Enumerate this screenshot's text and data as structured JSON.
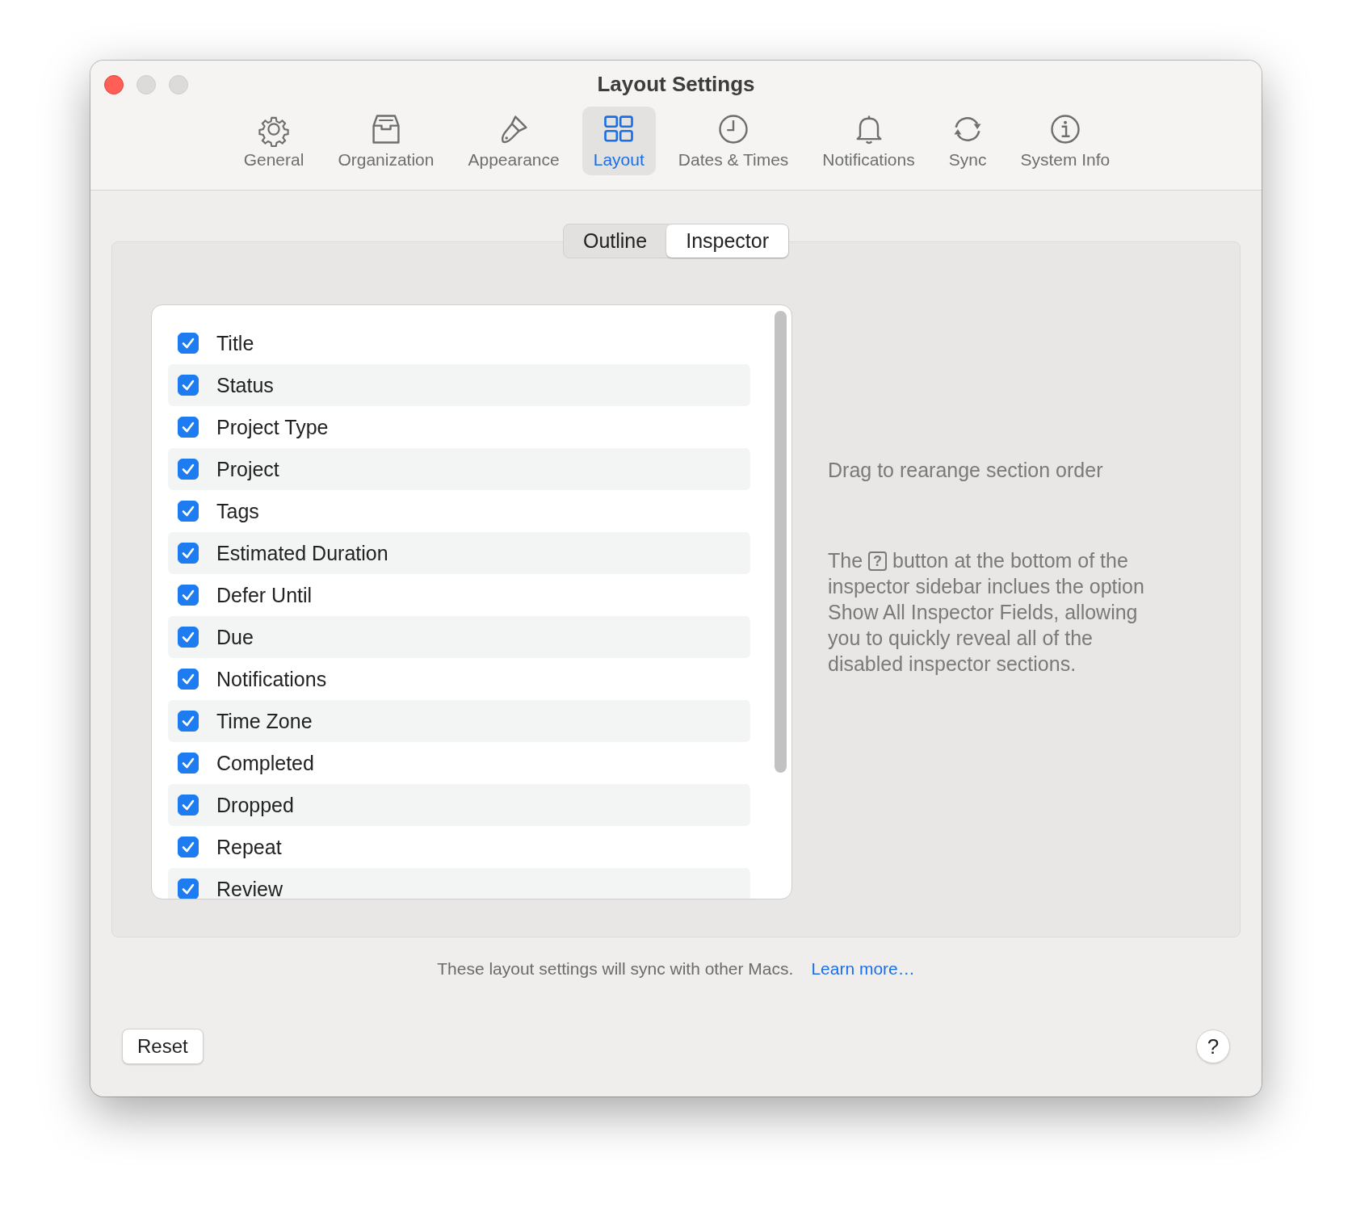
{
  "window": {
    "title": "Layout Settings"
  },
  "toolbar": [
    {
      "label": "General",
      "selected": false
    },
    {
      "label": "Organization",
      "selected": false
    },
    {
      "label": "Appearance",
      "selected": false
    },
    {
      "label": "Layout",
      "selected": true
    },
    {
      "label": "Dates & Times",
      "selected": false
    },
    {
      "label": "Notifications",
      "selected": false
    },
    {
      "label": "Sync",
      "selected": false
    },
    {
      "label": "System Info",
      "selected": false
    }
  ],
  "segments": [
    {
      "label": "Outline",
      "selected": false
    },
    {
      "label": "Inspector",
      "selected": true
    }
  ],
  "sections": [
    {
      "label": "Title",
      "checked": true
    },
    {
      "label": "Status",
      "checked": true
    },
    {
      "label": "Project Type",
      "checked": true
    },
    {
      "label": "Project",
      "checked": true
    },
    {
      "label": "Tags",
      "checked": true
    },
    {
      "label": "Estimated Duration",
      "checked": true
    },
    {
      "label": "Defer Until",
      "checked": true
    },
    {
      "label": "Due",
      "checked": true
    },
    {
      "label": "Notifications",
      "checked": true
    },
    {
      "label": "Time Zone",
      "checked": true
    },
    {
      "label": "Completed",
      "checked": true
    },
    {
      "label": "Dropped",
      "checked": true
    },
    {
      "label": "Repeat",
      "checked": true
    },
    {
      "label": "Review",
      "checked": true
    }
  ],
  "hint": "Drag to rearange section order",
  "help_note": {
    "before": "The",
    "icon_glyph": "?",
    "after": "button at the bottom of the inspector sidebar inclues the option Show All Inspector Fields, allowing you to quickly reveal all of the disabled inspector sections."
  },
  "footer": {
    "text": "These layout settings will sync with other Macs.",
    "link": "Learn more…"
  },
  "buttons": {
    "reset": "Reset",
    "help": "?"
  }
}
